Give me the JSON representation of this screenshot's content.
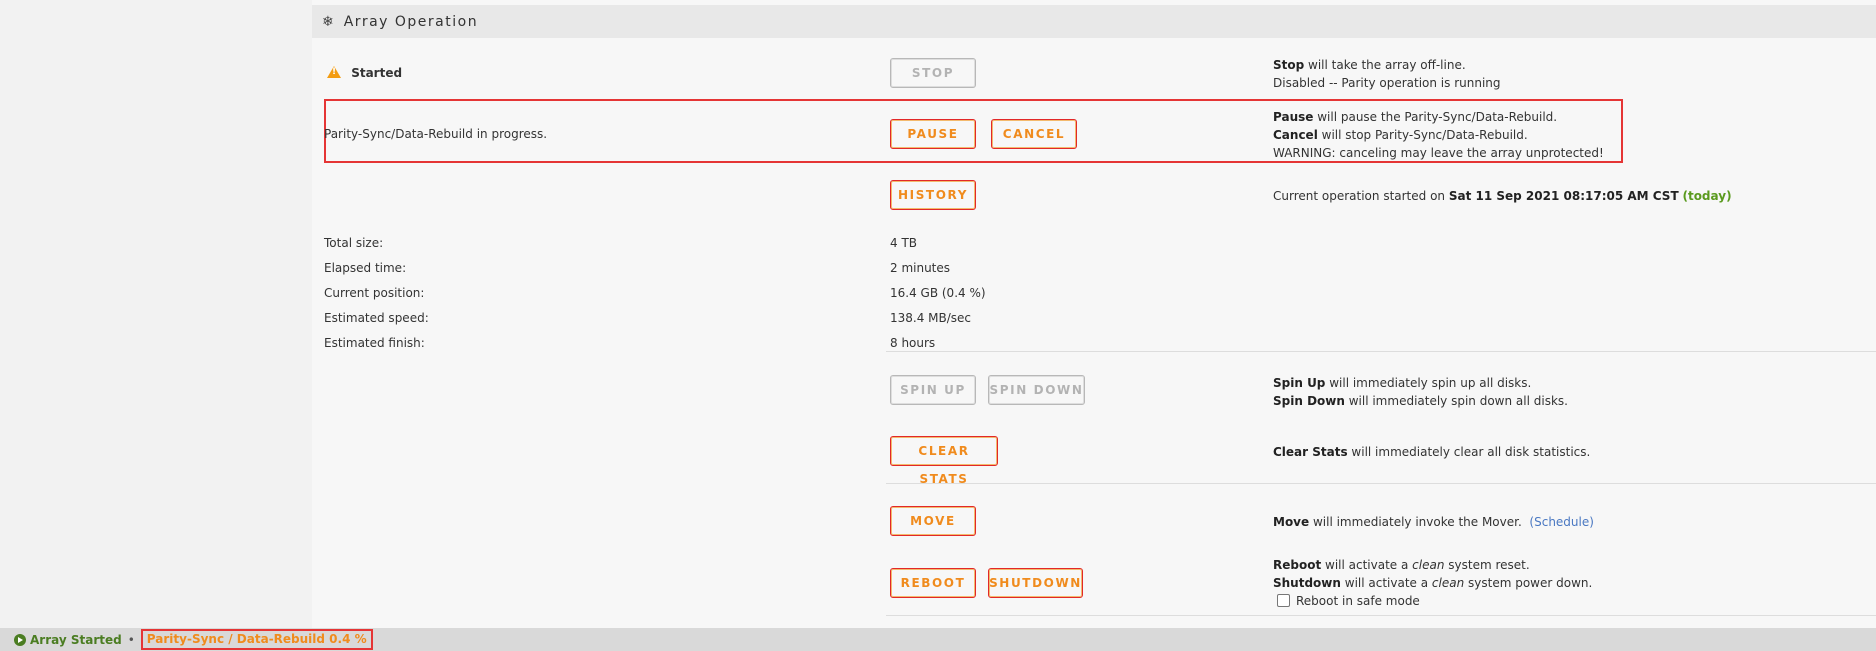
{
  "section": {
    "icon": "snowflake-icon",
    "title": "Array Operation"
  },
  "status": {
    "label": "Started",
    "icon": "warning-icon"
  },
  "stop": {
    "button": "STOP",
    "desc_bold": "Stop",
    "desc_rest": " will take the array off-line.",
    "desc_line2": "Disabled -- Parity operation is running"
  },
  "parity": {
    "text": "Parity-Sync/Data-Rebuild in progress.",
    "pause_button": "PAUSE",
    "cancel_button": "CANCEL",
    "pause_bold": "Pause",
    "pause_rest": " will pause the Parity-Sync/Data-Rebuild.",
    "cancel_bold": "Cancel",
    "cancel_rest": " will stop Parity-Sync/Data-Rebuild.",
    "warning": "WARNING: canceling may leave the array unprotected!"
  },
  "history": {
    "button": "HISTORY",
    "desc_prefix": "Current operation started on ",
    "date": "Sat 11 Sep 2021 08:17:05 AM CST",
    "today": "(today)"
  },
  "stats": [
    {
      "label": "Total size:",
      "value": "4 TB"
    },
    {
      "label": "Elapsed time:",
      "value": "2 minutes"
    },
    {
      "label": "Current position:",
      "value": "16.4 GB (0.4 %)"
    },
    {
      "label": "Estimated speed:",
      "value": "138.4 MB/sec"
    },
    {
      "label": "Estimated finish:",
      "value": "8 hours"
    }
  ],
  "spin": {
    "up_button": "SPIN UP",
    "down_button": "SPIN DOWN",
    "up_bold": "Spin Up",
    "up_rest": " will immediately spin up all disks.",
    "down_bold": "Spin Down",
    "down_rest": " will immediately spin down all disks."
  },
  "clear": {
    "button": "CLEAR STATS",
    "bold": "Clear Stats",
    "rest": " will immediately clear all disk statistics."
  },
  "move": {
    "button": "MOVE",
    "bold": "Move",
    "rest": " will immediately invoke the Mover.",
    "link": "(Schedule)"
  },
  "power": {
    "reboot_button": "REBOOT",
    "shutdown_button": "SHUTDOWN",
    "reboot_bold": "Reboot",
    "reboot_mid": " will activate a ",
    "reboot_em": "clean",
    "reboot_end": " system reset.",
    "shutdown_bold": "Shutdown",
    "shutdown_mid": " will activate a ",
    "shutdown_em": "clean",
    "shutdown_end": " system power down.",
    "safe_mode": "Reboot in safe mode"
  },
  "footer": {
    "status": "Array Started",
    "separator": "•",
    "progress": "Parity-Sync / Data-Rebuild 0.4 %"
  },
  "colors": {
    "accent": "#f08b1d",
    "border": "#e22828",
    "green": "#4b7d22",
    "link": "#4a78c2"
  }
}
